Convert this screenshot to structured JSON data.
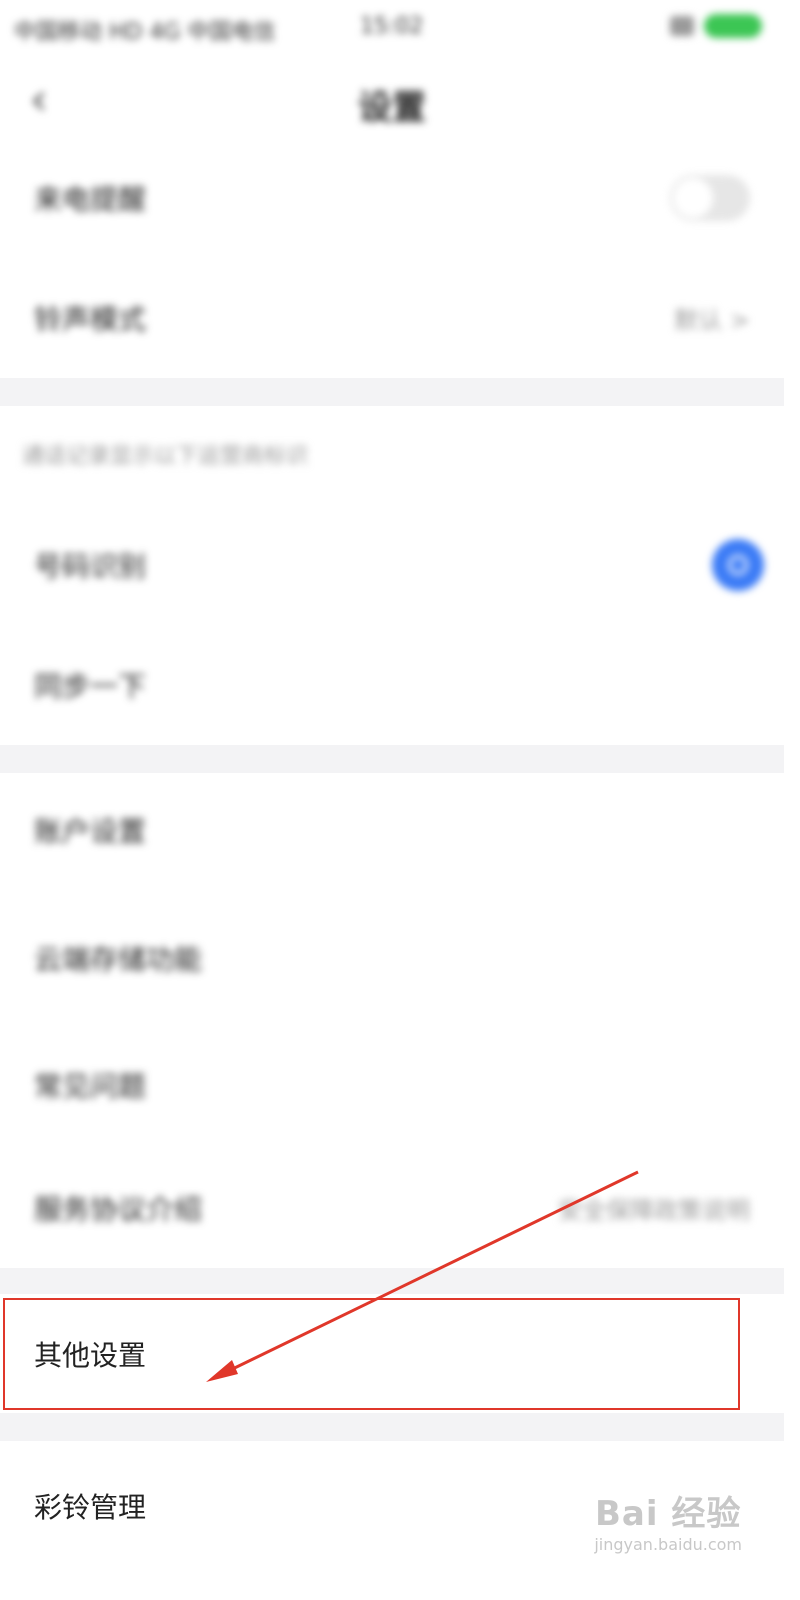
{
  "status_bar": {
    "carrier": "中国移动 HD 4G 中国电信",
    "time": "15:02",
    "wifi_icon": "wifi-icon",
    "battery_icon": "battery-icon"
  },
  "nav": {
    "back_icon": "‹",
    "title": "设置"
  },
  "group1": [
    {
      "label": "来电提醒",
      "control": "toggle-off"
    },
    {
      "label": "铃声模式",
      "value": "默认 >"
    }
  ],
  "section2_header": "通话记录显示以下运营商标识",
  "group2": [
    {
      "label": "号码识别",
      "control": "radio-checked"
    },
    {
      "label": "同步一下"
    }
  ],
  "group3": [
    {
      "label": "账户设置"
    },
    {
      "label": "云端存储功能"
    },
    {
      "label": "常见问题"
    },
    {
      "label": "服务协议介绍",
      "value": "安全保障政策说明"
    }
  ],
  "highlighted_item": {
    "label": "其他设置"
  },
  "ringtone_item": {
    "label": "彩铃管理"
  },
  "watermark": {
    "main": "Bai 经验",
    "sub": "jingyan.baidu.com"
  },
  "colors": {
    "accent": "#3b7bf6",
    "annotation": "#e0372a",
    "battery": "#3cc654"
  }
}
